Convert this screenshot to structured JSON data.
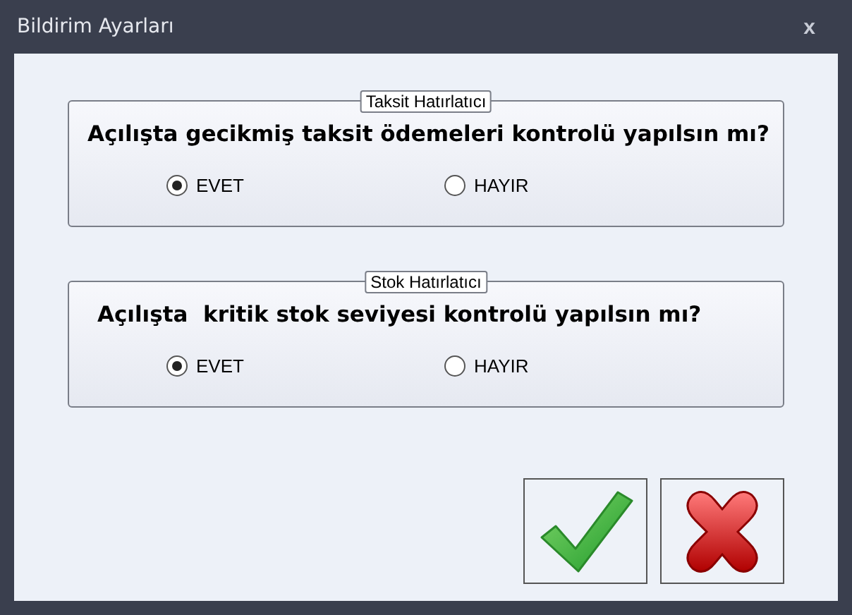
{
  "window": {
    "title": "Bildirim Ayarları",
    "close": "x"
  },
  "groups": [
    {
      "legend": "Taksit Hatırlatıcı",
      "question": "Açılışta gecikmiş taksit ödemeleri kontrolü yapılsın mı?",
      "options": [
        {
          "label": "EVET",
          "selected": true
        },
        {
          "label": "HAYIR",
          "selected": false
        }
      ]
    },
    {
      "legend": "Stok Hatırlatıcı",
      "question": "Açılışta  kritik stok seviyesi kontrolü yapılsın mı?",
      "options": [
        {
          "label": "EVET",
          "selected": true
        },
        {
          "label": "HAYIR",
          "selected": false
        }
      ]
    }
  ],
  "buttons": [
    {
      "kind": "ok"
    },
    {
      "kind": "cancel"
    }
  ]
}
